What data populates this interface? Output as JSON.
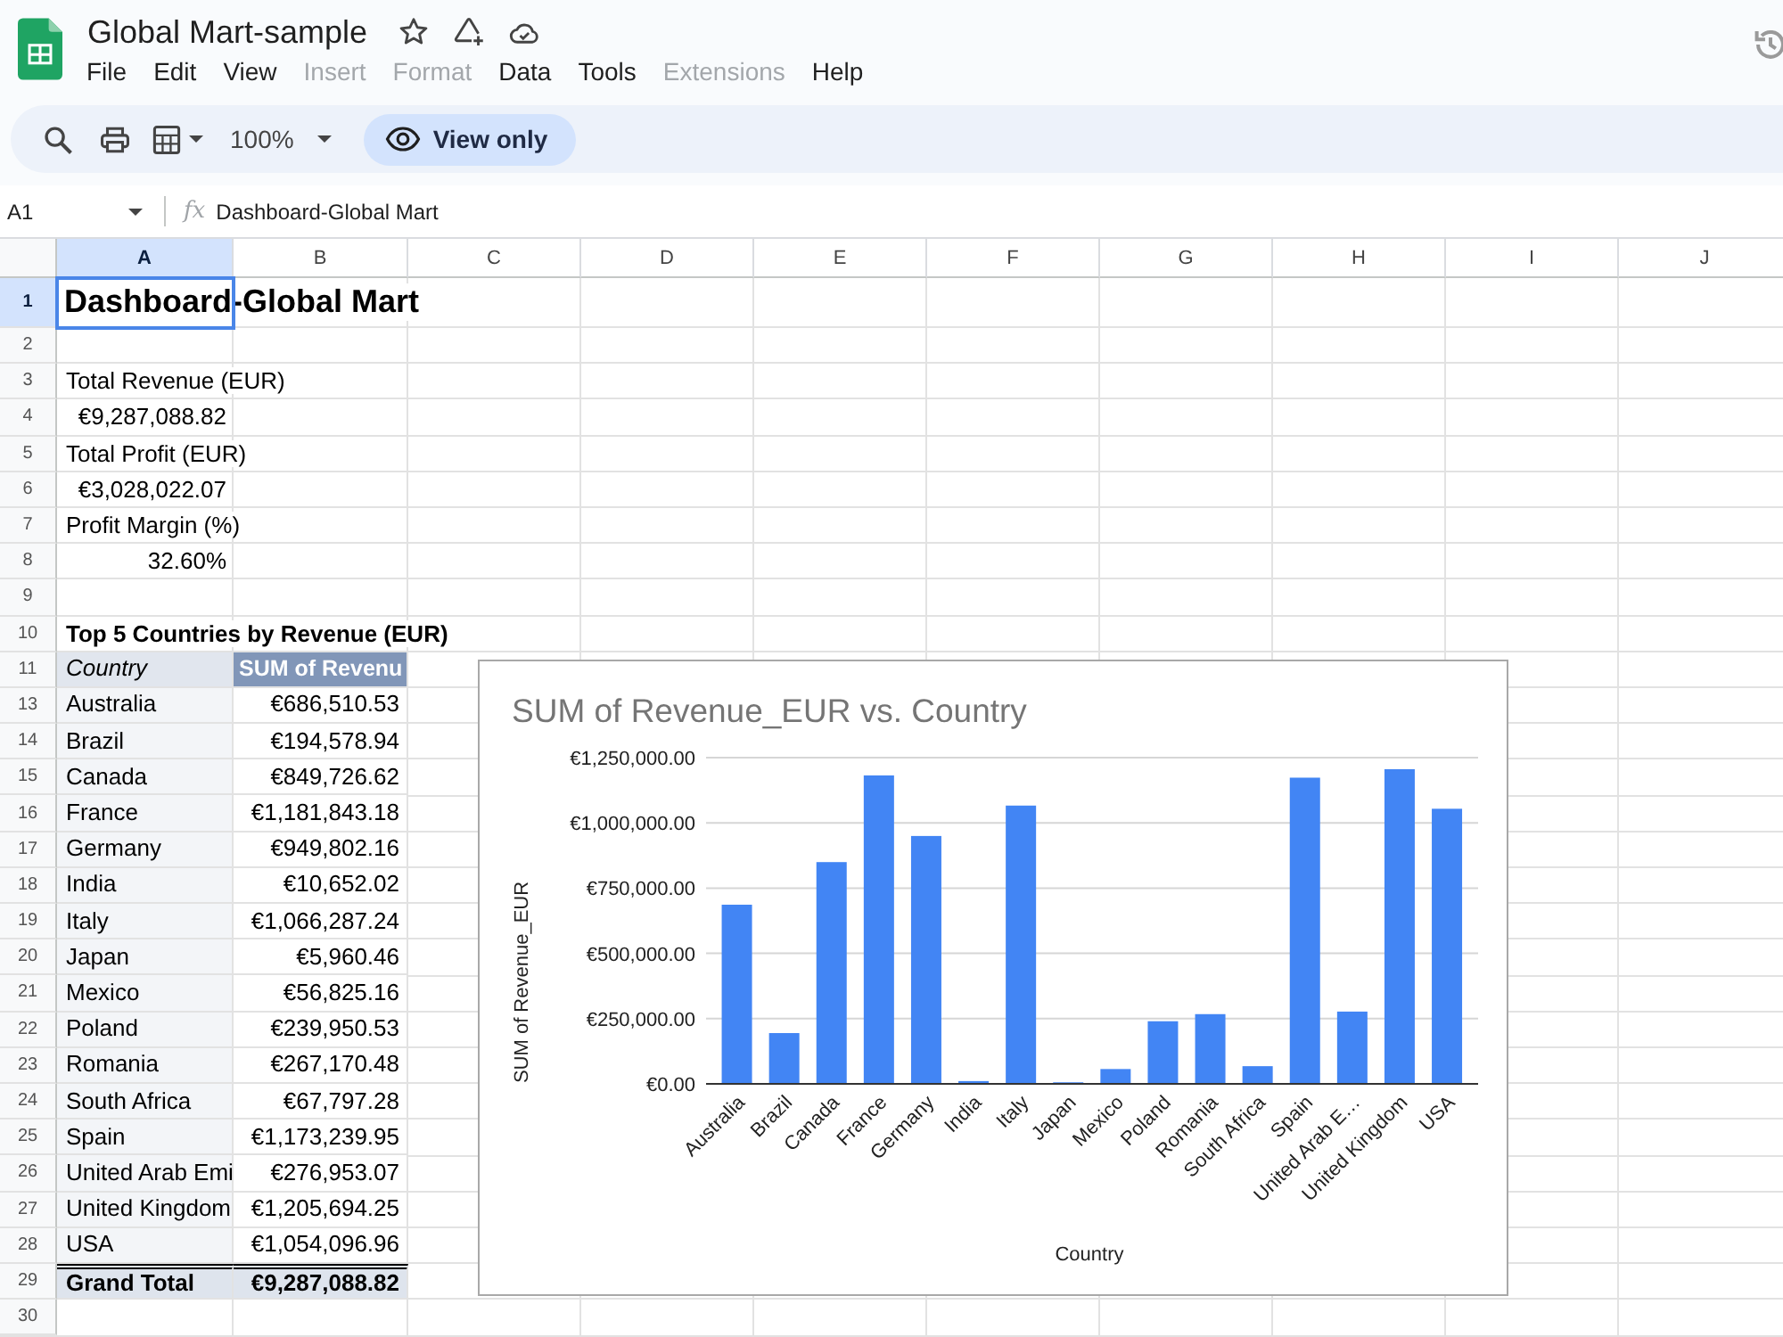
{
  "window": {
    "title": "Global Mart-sample"
  },
  "menu": [
    {
      "label": "File",
      "disabled": false
    },
    {
      "label": "Edit",
      "disabled": false
    },
    {
      "label": "View",
      "disabled": false
    },
    {
      "label": "Insert",
      "disabled": true
    },
    {
      "label": "Format",
      "disabled": true
    },
    {
      "label": "Data",
      "disabled": false
    },
    {
      "label": "Tools",
      "disabled": false
    },
    {
      "label": "Extensions",
      "disabled": true
    },
    {
      "label": "Help",
      "disabled": false
    }
  ],
  "toolbar": {
    "zoom": "100%",
    "view_mode": "View only"
  },
  "formula_bar": {
    "cell": "A1",
    "fx": "fx",
    "value": "Dashboard-Global Mart"
  },
  "sheet": {
    "columns": [
      {
        "label": "A",
        "selected": true
      },
      {
        "label": "B",
        "selected": false
      },
      {
        "label": "C",
        "selected": false
      },
      {
        "label": "D",
        "selected": false
      },
      {
        "label": "E",
        "selected": false
      },
      {
        "label": "F",
        "selected": false
      },
      {
        "label": "G",
        "selected": false
      },
      {
        "label": "H",
        "selected": false
      },
      {
        "label": "I",
        "selected": false
      },
      {
        "label": "J",
        "selected": false
      }
    ],
    "rows": [
      {
        "number": "1",
        "selected": true,
        "cells": [
          {
            "kind": "title",
            "text": "Dashboard-Global Mart"
          }
        ]
      },
      {
        "number": "2",
        "selected": false
      },
      {
        "number": "3",
        "selected": false,
        "cells": [
          {
            "kind": "label",
            "text": "Total Revenue (EUR)"
          }
        ]
      },
      {
        "number": "4",
        "selected": false,
        "cells": [
          {
            "kind": "number",
            "text": "€9,287,088.82"
          }
        ]
      },
      {
        "number": "5",
        "selected": false,
        "cells": [
          {
            "kind": "label",
            "text": "Total Profit (EUR)"
          }
        ]
      },
      {
        "number": "6",
        "selected": false,
        "cells": [
          {
            "kind": "number",
            "text": "€3,028,022.07"
          }
        ]
      },
      {
        "number": "7",
        "selected": false,
        "cells": [
          {
            "kind": "label",
            "text": "Profit Margin (%)"
          }
        ]
      },
      {
        "number": "8",
        "selected": false,
        "cells": [
          {
            "kind": "number",
            "text": "32.60%"
          }
        ]
      },
      {
        "number": "9",
        "selected": false
      },
      {
        "number": "10",
        "selected": false,
        "cells": [
          {
            "kind": "heading",
            "text": "Top 5 Countries by Revenue (EUR)"
          }
        ]
      },
      {
        "number": "11",
        "selected": false,
        "cells": [
          {
            "kind": "pivot_header_label",
            "text": "Country"
          },
          {
            "kind": "pivot_header_value",
            "text": "SUM of Revenu"
          }
        ]
      },
      {
        "number": "13",
        "selected": false,
        "cells": [
          {
            "kind": "pivot_label",
            "text": "Australia"
          },
          {
            "kind": "pivot_value",
            "text": "€686,510.53"
          }
        ]
      },
      {
        "number": "14",
        "selected": false,
        "cells": [
          {
            "kind": "pivot_label",
            "text": "Brazil"
          },
          {
            "kind": "pivot_value",
            "text": "€194,578.94"
          }
        ]
      },
      {
        "number": "15",
        "selected": false,
        "cells": [
          {
            "kind": "pivot_label",
            "text": "Canada"
          },
          {
            "kind": "pivot_value",
            "text": "€849,726.62"
          }
        ]
      },
      {
        "number": "16",
        "selected": false,
        "cells": [
          {
            "kind": "pivot_label",
            "text": "France"
          },
          {
            "kind": "pivot_value",
            "text": "€1,181,843.18"
          }
        ]
      },
      {
        "number": "17",
        "selected": false,
        "cells": [
          {
            "kind": "pivot_label",
            "text": "Germany"
          },
          {
            "kind": "pivot_value",
            "text": "€949,802.16"
          }
        ]
      },
      {
        "number": "18",
        "selected": false,
        "cells": [
          {
            "kind": "pivot_label",
            "text": "India"
          },
          {
            "kind": "pivot_value",
            "text": "€10,652.02"
          }
        ]
      },
      {
        "number": "19",
        "selected": false,
        "cells": [
          {
            "kind": "pivot_label",
            "text": "Italy"
          },
          {
            "kind": "pivot_value",
            "text": "€1,066,287.24"
          }
        ]
      },
      {
        "number": "20",
        "selected": false,
        "cells": [
          {
            "kind": "pivot_label",
            "text": "Japan"
          },
          {
            "kind": "pivot_value",
            "text": "€5,960.46"
          }
        ]
      },
      {
        "number": "21",
        "selected": false,
        "cells": [
          {
            "kind": "pivot_label",
            "text": "Mexico"
          },
          {
            "kind": "pivot_value",
            "text": "€56,825.16"
          }
        ]
      },
      {
        "number": "22",
        "selected": false,
        "cells": [
          {
            "kind": "pivot_label",
            "text": "Poland"
          },
          {
            "kind": "pivot_value",
            "text": "€239,950.53"
          }
        ]
      },
      {
        "number": "23",
        "selected": false,
        "cells": [
          {
            "kind": "pivot_label",
            "text": "Romania"
          },
          {
            "kind": "pivot_value",
            "text": "€267,170.48"
          }
        ]
      },
      {
        "number": "24",
        "selected": false,
        "cells": [
          {
            "kind": "pivot_label",
            "text": "South Africa"
          },
          {
            "kind": "pivot_value",
            "text": "€67,797.28"
          }
        ]
      },
      {
        "number": "25",
        "selected": false,
        "cells": [
          {
            "kind": "pivot_label",
            "text": "Spain"
          },
          {
            "kind": "pivot_value",
            "text": "€1,173,239.95"
          }
        ]
      },
      {
        "number": "26",
        "selected": false,
        "cells": [
          {
            "kind": "pivot_label",
            "text": "United Arab Emi"
          },
          {
            "kind": "pivot_value",
            "text": "€276,953.07"
          }
        ]
      },
      {
        "number": "27",
        "selected": false,
        "cells": [
          {
            "kind": "pivot_label",
            "text": "United Kingdom"
          },
          {
            "kind": "pivot_value",
            "text": "€1,205,694.25"
          }
        ]
      },
      {
        "number": "28",
        "selected": false,
        "cells": [
          {
            "kind": "pivot_label",
            "text": "USA"
          },
          {
            "kind": "pivot_value",
            "text": "€1,054,096.96"
          }
        ]
      },
      {
        "number": "29",
        "selected": false,
        "cells": [
          {
            "kind": "total_label",
            "text": "Grand Total"
          },
          {
            "kind": "total_value",
            "text": "€9,287,088.82"
          }
        ]
      },
      {
        "number": "30",
        "selected": false
      }
    ],
    "chart": {
      "chart_data": {
        "type": "bar",
        "title": "SUM of Revenue_EUR vs. Country",
        "xlabel": "Country",
        "ylabel": "SUM of Revenue_EUR",
        "categories": [
          "Australia",
          "Brazil",
          "Canada",
          "France",
          "Germany",
          "India",
          "Italy",
          "Japan",
          "Mexico",
          "Poland",
          "Romania",
          "South Africa",
          "Spain",
          "United Arab E…",
          "United Kingdom",
          "USA"
        ],
        "values": [
          686510.53,
          194578.94,
          849726.62,
          1181843.18,
          949802.16,
          10652.02,
          1066287.24,
          5960.46,
          56825.16,
          239950.53,
          267170.48,
          67797.28,
          1173239.95,
          276953.07,
          1205694.25,
          1054096.96
        ],
        "color": "#4285f4",
        "ylim": [
          0,
          1250000
        ],
        "yticks": [
          {
            "value": 0,
            "label": "€0.00"
          },
          {
            "value": 250000,
            "label": "€250,000.00"
          },
          {
            "value": 500000,
            "label": "€500,000.00"
          },
          {
            "value": 750000,
            "label": "€750,000.00"
          },
          {
            "value": 1000000,
            "label": "€1,000,000.00"
          },
          {
            "value": 1250000,
            "label": "€1,250,000.00"
          }
        ],
        "grid": true
      }
    }
  }
}
